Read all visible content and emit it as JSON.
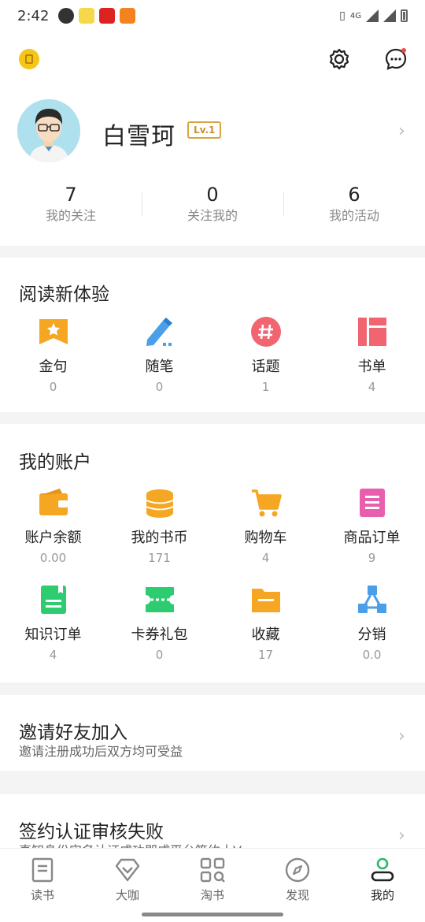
{
  "status_bar": {
    "time": "2:42",
    "network": "4G"
  },
  "profile": {
    "username": "白雪珂",
    "level": "Lv.1",
    "stats": [
      {
        "num": "7",
        "label": "我的关注"
      },
      {
        "num": "0",
        "label": "关注我的"
      },
      {
        "num": "6",
        "label": "我的活动"
      }
    ]
  },
  "reading": {
    "title": "阅读新体验",
    "items": [
      {
        "name": "金句",
        "value": "0",
        "icon": "star-bookmark-icon",
        "color": "#f5a623"
      },
      {
        "name": "随笔",
        "value": "0",
        "icon": "pencil-icon",
        "color": "#4a9fe8"
      },
      {
        "name": "话题",
        "value": "1",
        "icon": "hashtag-icon",
        "color": "#f06570"
      },
      {
        "name": "书单",
        "value": "4",
        "icon": "booklist-icon",
        "color": "#f06570"
      }
    ]
  },
  "account": {
    "title": "我的账户",
    "items": [
      {
        "name": "账户余额",
        "value": "0.00",
        "icon": "wallet-icon",
        "color": "#f5a623"
      },
      {
        "name": "我的书币",
        "value": "171",
        "icon": "coins-icon",
        "color": "#f5a623"
      },
      {
        "name": "购物车",
        "value": "4",
        "icon": "cart-icon",
        "color": "#f5a623"
      },
      {
        "name": "商品订单",
        "value": "9",
        "icon": "order-icon",
        "color": "#e85fae"
      },
      {
        "name": "知识订单",
        "value": "4",
        "icon": "knowledge-order-icon",
        "color": "#2ecc71"
      },
      {
        "name": "卡券礼包",
        "value": "0",
        "icon": "coupon-icon",
        "color": "#2ecc71"
      },
      {
        "name": "收藏",
        "value": "17",
        "icon": "folder-icon",
        "color": "#f5a623"
      },
      {
        "name": "分销",
        "value": "0.0",
        "icon": "share-network-icon",
        "color": "#4a9fe8"
      }
    ]
  },
  "invite": {
    "title": "邀请好友加入",
    "subtitle": "邀请注册成功后双方均可受益"
  },
  "sign": {
    "title": "签约认证审核失败",
    "subtitle": "真知身份实名认证成功即成平台签约大V"
  },
  "tabs": [
    {
      "label": "读书",
      "icon": "book-icon"
    },
    {
      "label": "大咖",
      "icon": "diamond-icon"
    },
    {
      "label": "淘书",
      "icon": "grid-search-icon"
    },
    {
      "label": "发现",
      "icon": "compass-icon"
    },
    {
      "label": "我的",
      "icon": "user-icon",
      "active": true
    }
  ],
  "colors": {
    "accent": "#2bb673",
    "brand_gold": "#f5c518"
  }
}
